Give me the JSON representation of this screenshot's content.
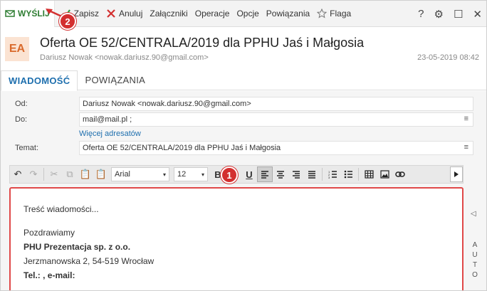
{
  "toolbar": {
    "send": "WYŚLIJ",
    "save": "Zapisz",
    "cancel": "Anuluj",
    "attachments": "Załączniki",
    "operations": "Operacje",
    "options": "Opcje",
    "links": "Powiązania",
    "flag": "Flaga",
    "help": "?",
    "settings": "⚙",
    "window": "☐",
    "close": "✕"
  },
  "badges": {
    "one": "1",
    "two": "2"
  },
  "header": {
    "avatar": "EA",
    "subject": "Oferta OE 52/CENTRALA/2019 dla PPHU Jaś i Małgosia",
    "from": "Dariusz Nowak <nowak.dariusz.90@gmail.com>",
    "date": "23-05-2019 08:42"
  },
  "tabs": [
    "WIADOMOŚĆ",
    "POWIĄZANIA"
  ],
  "form": {
    "from_label": "Od:",
    "from_value": "Dariusz Nowak <nowak.dariusz.90@gmail.com>",
    "to_label": "Do:",
    "to_value": "mail@mail.pl ;",
    "more_addresses": "Więcej adresatów",
    "subject_label": "Temat:",
    "subject_value": "Oferta OE 52/CENTRALA/2019 dla PPHU Jaś i Małgosia"
  },
  "editor_toolbar": {
    "font": "Arial",
    "size": "12"
  },
  "editor": {
    "line1": "Treść wiadomości...",
    "line2": "Pozdrawiamy",
    "line3": "PHU Prezentacja sp. z o.o.",
    "line4": "Jerzmanowska 2, 54-519 Wrocław",
    "line5": "Tel.: , e-mail:"
  },
  "side": {
    "arrow": "◁",
    "letters": "AUTO"
  },
  "colors": {
    "send_green": "#2e7d32",
    "cancel_red": "#d32f2f",
    "tab_blue": "#1e6fae",
    "avatar_bg": "#fbe3d2",
    "avatar_fg": "#d9692a",
    "badge_red": "#d32f2f"
  }
}
